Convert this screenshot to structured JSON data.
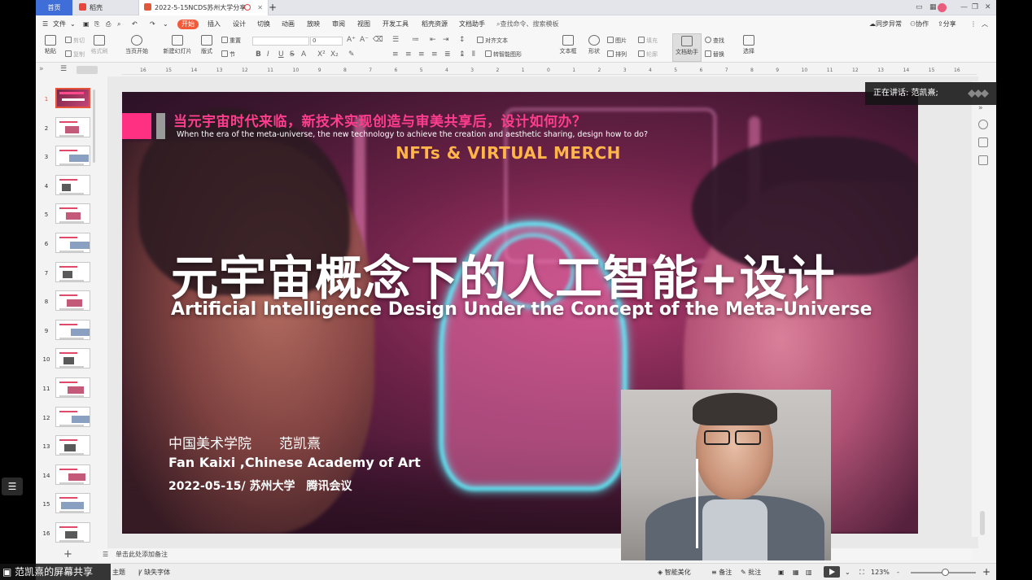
{
  "tabs": {
    "home": "首页",
    "daoke": "稻壳",
    "doc": "2022-5-15NCDS苏州大学分享",
    "plus": "+"
  },
  "menu": {
    "file": "文件",
    "start": "开始",
    "items": [
      "插入",
      "设计",
      "切换",
      "动画",
      "放映",
      "审阅",
      "视图",
      "开发工具",
      "稻壳资源",
      "文档助手"
    ],
    "search": "查找命令、搜索模板",
    "sync": "同步异常",
    "collab": "协作",
    "share": "分享"
  },
  "ribbon": {
    "paste": "粘贴",
    "cut": "剪切",
    "copy": "复制",
    "format_painter": "格式刷",
    "slideshow_from_current": "当页开始",
    "new_slide": "新建幻灯片",
    "layout": "版式",
    "section": "节",
    "reset": "重置",
    "font_size": "0",
    "align_text": "对齐文本",
    "convert_smartart": "转智能图形",
    "textbox": "文本框",
    "shape": "形状",
    "arrange": "排列",
    "picture": "图片",
    "fill": "填充",
    "outline": "轮廓",
    "doc_helper": "文档助手",
    "find": "查找",
    "replace": "替换",
    "select": "选择"
  },
  "ruler_ticks": [
    "16",
    "15",
    "14",
    "13",
    "12",
    "11",
    "10",
    "9",
    "8",
    "7",
    "6",
    "5",
    "4",
    "3",
    "2",
    "1",
    "0",
    "1",
    "2",
    "3",
    "4",
    "5",
    "6",
    "7",
    "8",
    "9",
    "10",
    "11",
    "12",
    "13",
    "14",
    "15",
    "16"
  ],
  "slides": [
    {
      "num": "1",
      "selected": true
    },
    {
      "num": "2"
    },
    {
      "num": "3"
    },
    {
      "num": "4"
    },
    {
      "num": "5"
    },
    {
      "num": "6"
    },
    {
      "num": "7"
    },
    {
      "num": "8"
    },
    {
      "num": "9"
    },
    {
      "num": "10"
    },
    {
      "num": "11"
    },
    {
      "num": "12"
    },
    {
      "num": "13"
    },
    {
      "num": "14"
    },
    {
      "num": "15"
    },
    {
      "num": "16"
    }
  ],
  "slide": {
    "title_cn": "当元宇宙时代来临，新技术实现创造与审美共享后，设计如何办？",
    "title_en": "When the era of the meta-universe, the new technology to achieve the creation and aesthetic sharing, design how to do?",
    "nft": "NFTs & VIRTUAL MERCH",
    "main_cn": "元宇宙概念下的人工智能+设计",
    "main_en": "Artificial Intelligence Design Under the Concept of the Meta-Universe",
    "author_cn": "中国美术学院　　范凯熹",
    "author_en": "Fan Kaixi ,Chinese Academy of Art",
    "date": "2022-05-15/ 苏州大学　腾讯会议"
  },
  "notes_placeholder": "单击此处添加备注",
  "status": {
    "theme": "主题",
    "missing_font": "缺失字体",
    "smart_beautify": "智能美化",
    "notes": "备注",
    "comments": "批注",
    "zoom": "123%",
    "minus": "-",
    "plus": "+"
  },
  "meeting": {
    "speaking": "正在讲话: 范凯熹;",
    "share_label": "范凯熹的屏幕共享"
  },
  "colors": {
    "accent_pink": "#ff2f82",
    "nft_orange": "#ffb54a",
    "wps_red": "#f25a3a",
    "home_blue": "#3f6ed8"
  }
}
